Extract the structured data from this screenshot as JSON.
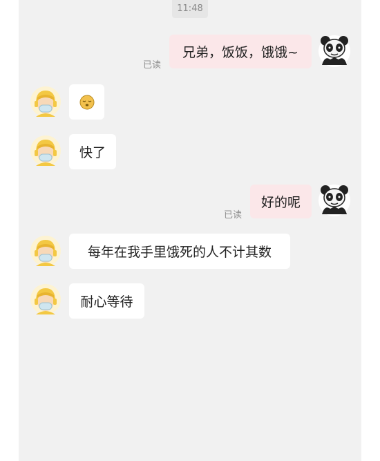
{
  "status": {
    "time": "11:48"
  },
  "messages": [
    {
      "side": "out",
      "text": "兄弟，饭饭，饿饿~",
      "read_status": "已读"
    },
    {
      "side": "in",
      "text": "",
      "emoji": "sleepy-face-emoji"
    },
    {
      "side": "in",
      "text": "快了"
    },
    {
      "side": "out",
      "text": "好的呢",
      "read_status": "已读"
    },
    {
      "side": "in",
      "text": "每年在我手里饿死的人不计其数"
    },
    {
      "side": "in",
      "text": "耐心等待"
    }
  ],
  "colors": {
    "chat_bg": "#f1f1f1",
    "incoming_bubble": "#ffffff",
    "outgoing_bubble": "#fbe7e9",
    "accent_avatar": "#f3c843"
  },
  "icons": {
    "contact_avatar": "masked-man-avatar-icon",
    "self_avatar": "panda-meme-avatar-icon"
  }
}
